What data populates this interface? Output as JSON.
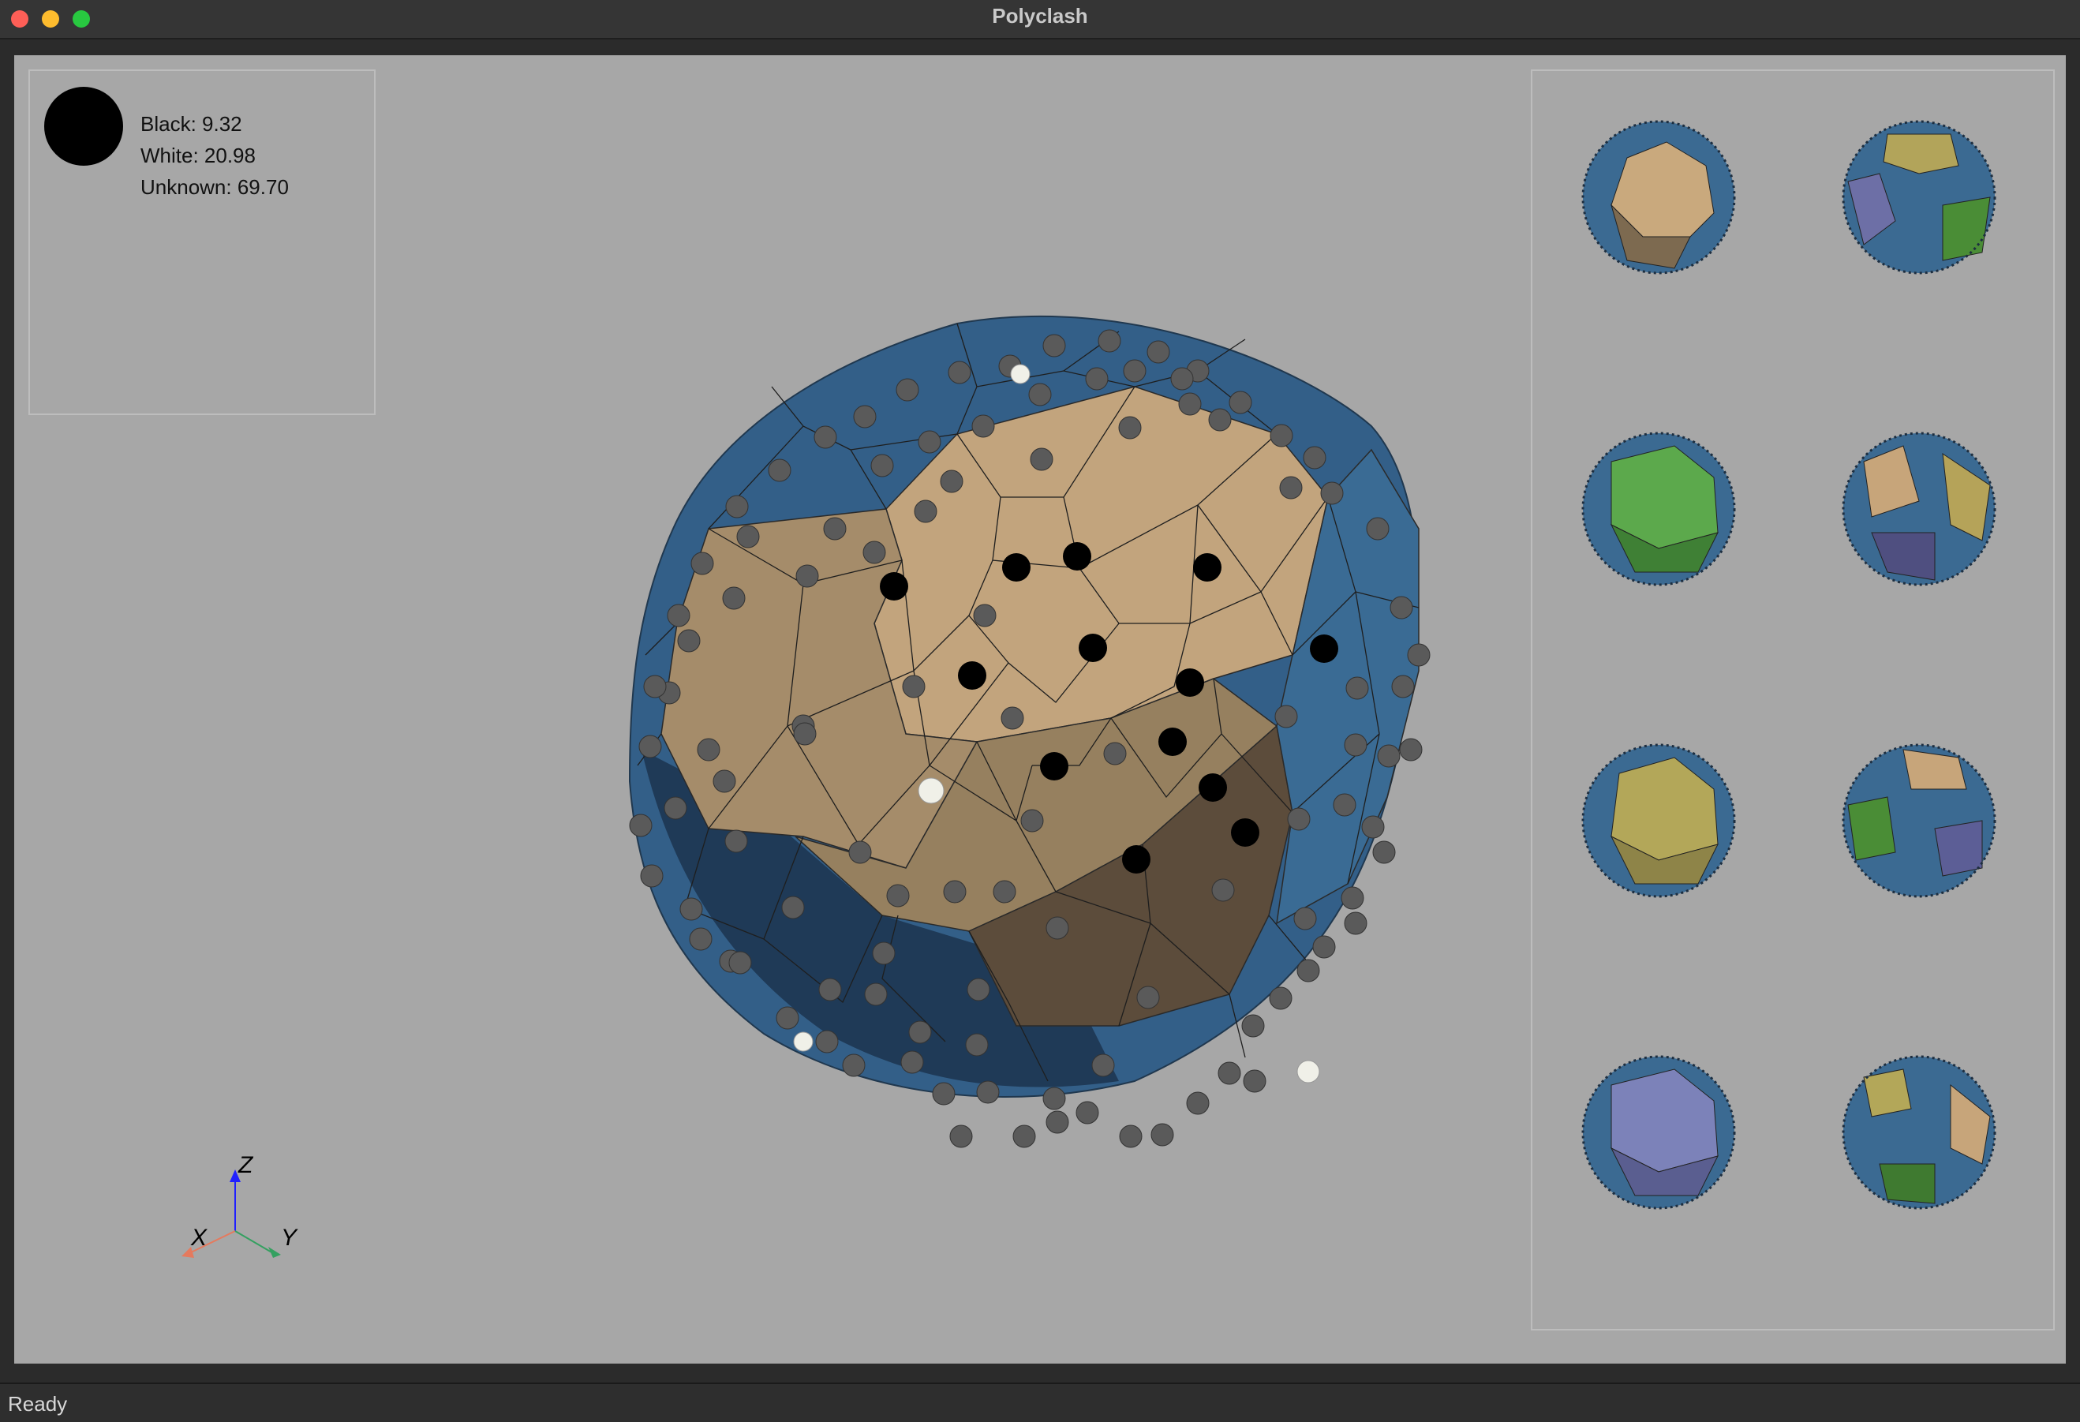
{
  "window": {
    "title": "Polyclash"
  },
  "score": {
    "turn_color": "#000000",
    "black": "Black: 9.32",
    "white": "White: 20.98",
    "unknown": "Unknown: 69.70"
  },
  "axes": {
    "x": "X",
    "y": "Y",
    "z": "Z"
  },
  "status": {
    "text": "Ready"
  },
  "colors": {
    "background": "#a7a7a7",
    "face_blue": "#3b6a92",
    "face_tan": "#c2a47d",
    "black_stone": "#000000",
    "white_stone": "#f0f0e8",
    "empty_point": "#555555"
  },
  "overview": [
    {
      "name": "view-1",
      "main": "#c7a57a"
    },
    {
      "name": "view-2",
      "main": "#b2a45a"
    },
    {
      "name": "view-3",
      "main": "#5ca94c"
    },
    {
      "name": "view-4",
      "main": "#b5a359"
    },
    {
      "name": "view-5",
      "main": "#b3a759"
    },
    {
      "name": "view-6",
      "main": "#c7a57a"
    },
    {
      "name": "view-7",
      "main": "#7c82b9"
    },
    {
      "name": "view-8",
      "main": "#b3a759"
    }
  ]
}
